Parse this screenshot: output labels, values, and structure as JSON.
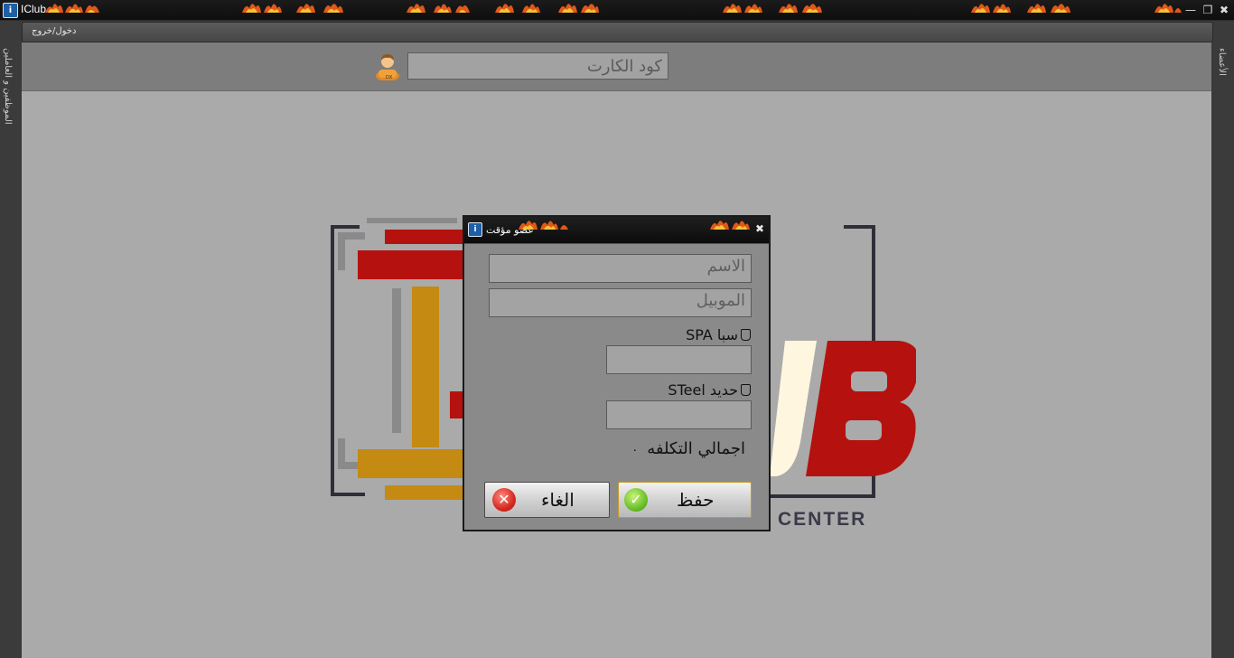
{
  "window": {
    "title": "IClub",
    "app_icon": "app-logo-icon",
    "controls": [
      "restore-icon",
      "maximize-icon",
      "close-icon"
    ]
  },
  "side_tabs": {
    "left": "الموظفين و العاملين",
    "right": "الأعضاء"
  },
  "menu": {
    "item": "دخول/خروج"
  },
  "top_panel": {
    "card_code_placeholder": "كود الكارت",
    "user_icon": "user-icon"
  },
  "logo": {
    "text": "CENTER",
    "colors": [
      "#b5120f",
      "#c48a12",
      "#8c8c8c",
      "#2f2f3a"
    ]
  },
  "dialog": {
    "title": "عضو مؤقت",
    "name_placeholder": "الاسم",
    "mobile_placeholder": "الموبيل",
    "spa_label": "سبا SPA",
    "steel_label": "حديد STeel",
    "total_label": "اجمالي التكلفه",
    "total_value": "٠",
    "save_label": "حفظ",
    "cancel_label": "الغاء"
  }
}
